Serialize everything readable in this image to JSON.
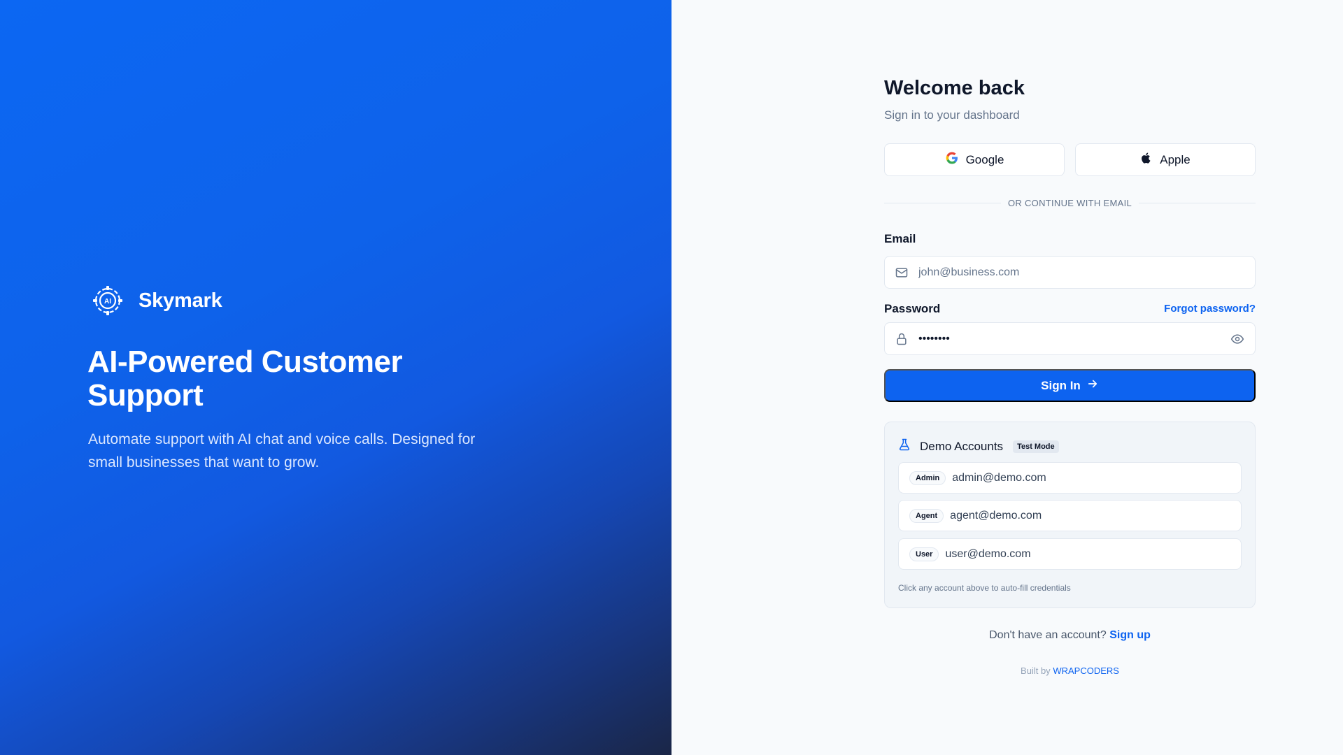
{
  "brand": {
    "name": "Skymark",
    "logo_icon": "gear-ai-icon",
    "tagline": "AI-Powered Customer Support",
    "description": "Automate support with AI chat and voice calls. Designed for small businesses that want to grow."
  },
  "login": {
    "title": "Welcome back",
    "subtitle": "Sign in to your dashboard",
    "google_label": "Google",
    "apple_label": "Apple",
    "divider_text": "OR CONTINUE WITH EMAIL",
    "email_label": "Email",
    "email_placeholder": "john@business.com",
    "password_label": "Password",
    "password_value": "••••••••",
    "forgot_label": "Forgot password?",
    "submit_label": "Sign In"
  },
  "demo": {
    "title": "Demo Accounts",
    "badge": "Test Mode",
    "accounts": [
      {
        "role": "Admin",
        "email": "admin@demo.com"
      },
      {
        "role": "Agent",
        "email": "agent@demo.com"
      },
      {
        "role": "User",
        "email": "user@demo.com"
      }
    ],
    "hint": "Click any account above to auto-fill credentials"
  },
  "footer": {
    "signup_prompt": "Don't have an account?",
    "signup_link": "Sign up",
    "built_by": "Built by",
    "built_by_name": "WRAPCODERS"
  },
  "colors": {
    "accent": "#0d63f0",
    "hero_start": "#0c67f3",
    "hero_end": "#1a2647",
    "page_bg": "#f8fafc"
  }
}
